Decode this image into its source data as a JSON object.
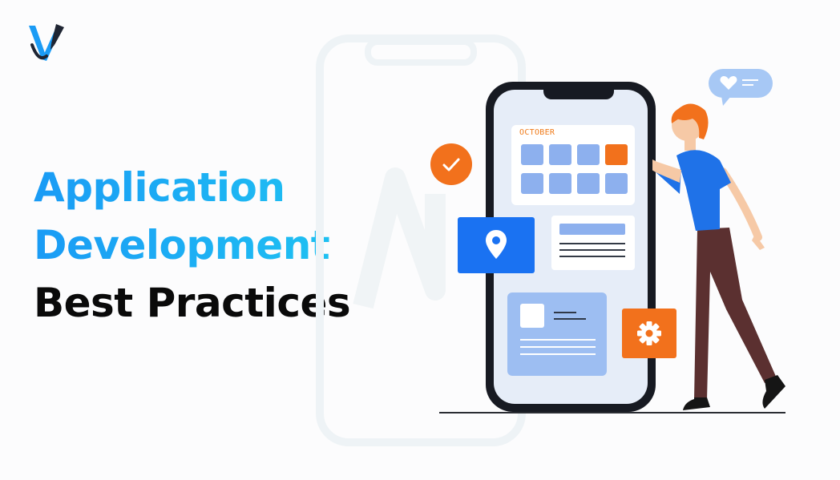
{
  "brand": {
    "logo_icon": "v-pen-logo-icon",
    "colors": {
      "logo_blue": "#1a9bf5",
      "logo_dark": "#1f2533"
    }
  },
  "headline": {
    "line1": "Application",
    "line2": "Development",
    "line3": "Best Practices",
    "accent_gradient": [
      "#1a9bf5",
      "#1fc3f2"
    ],
    "dark_color": "#0a0a0a"
  },
  "illustration": {
    "calendar_month": "OCTOBER",
    "icons": [
      "check-icon",
      "map-pin-icon",
      "gear-icon",
      "heart-icon"
    ],
    "colors": {
      "orange": "#f2711c",
      "blue": "#1a72f2",
      "light_blue": "#8db0ee",
      "screen": "#e6edf8",
      "phone_body": "#171a22"
    }
  }
}
